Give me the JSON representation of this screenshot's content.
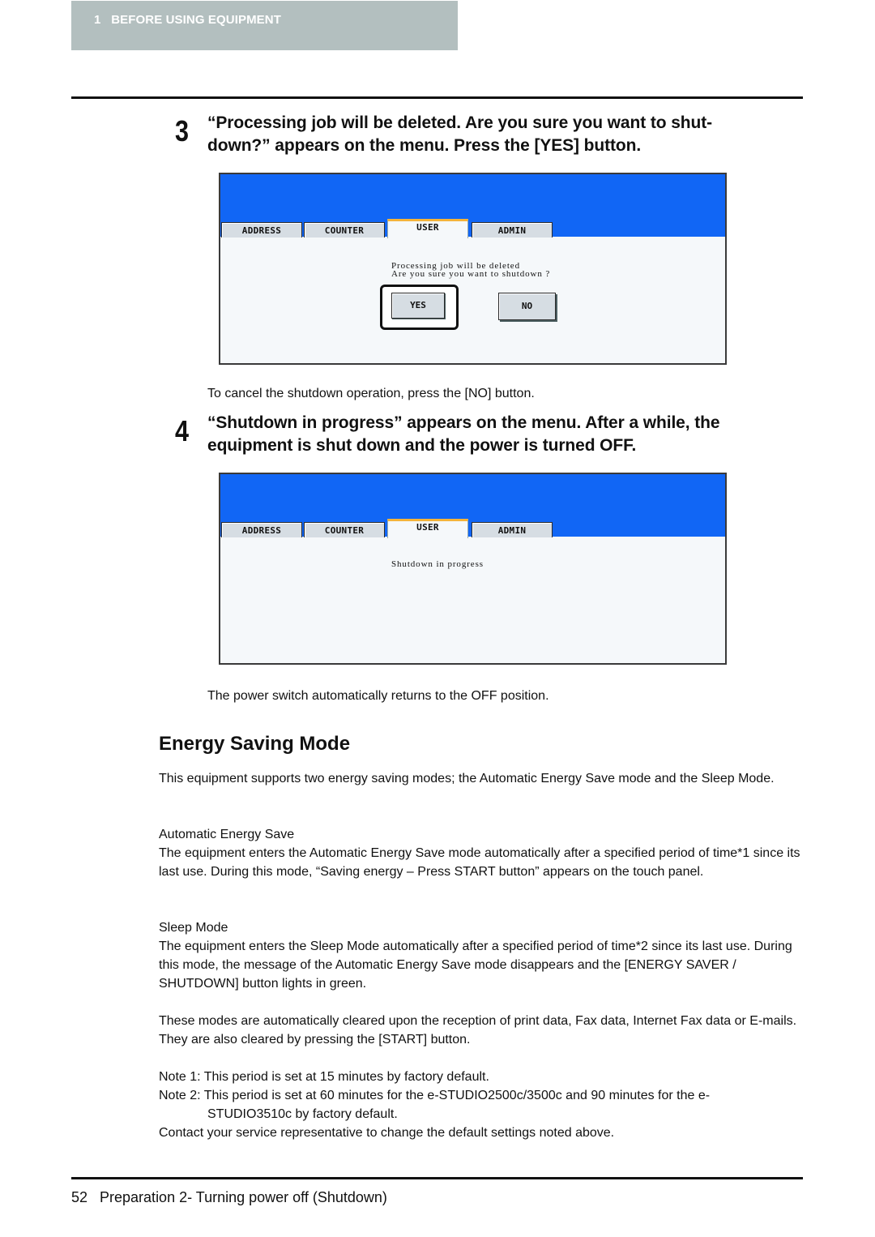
{
  "header": {
    "chapter_label": "1   BEFORE USING EQUIPMENT"
  },
  "colors": {
    "chapter_tab_bg": "#b3bfbf",
    "panel_header_blue": "#1166f5",
    "active_tab_accent": "#f5b43a",
    "button_face": "#d6dde3"
  },
  "steps": [
    {
      "number": "3",
      "text": "“Processing job will be deleted. Are you sure you want to shut-down?” appears on the menu. Press the [YES] button.",
      "line1": "“Processing job will be deleted. Are you sure you want to shut-",
      "line2": "down?” appears on the menu. Press the [YES] button."
    },
    {
      "number": "4",
      "line1": "“Shutdown in progress” appears on the menu. After a while, the",
      "line2": "equipment is shut down and the power is turned OFF."
    }
  ],
  "panel_confirm": {
    "tabs": [
      "ADDRESS",
      "COUNTER",
      "USER",
      "ADMIN"
    ],
    "active_tab": "USER",
    "message_line1": "Processing job will be deleted",
    "message_line2": "Are you sure you want to shutdown ?",
    "yes_label": "YES",
    "no_label": "NO",
    "highlighted_button": "YES"
  },
  "panel_progress": {
    "tabs": [
      "ADDRESS",
      "COUNTER",
      "USER",
      "ADMIN"
    ],
    "active_tab": "USER",
    "message": "Shutdown in progress"
  },
  "notes_after_panels": {
    "cancel_note": "To cancel the shutdown operation, press the [NO] button.",
    "power_note": "The power switch automatically returns to the OFF position."
  },
  "energy_section": {
    "heading": "Energy Saving Mode",
    "intro": "This equipment supports two energy saving modes; the Automatic Energy Save mode and the Sleep Mode.",
    "auto_title": "Automatic Energy Save",
    "auto_body": "The equipment enters the Automatic Energy Save mode automatically after a specified period of time*1 since its last use. During this mode, “Saving energy – Press START button” appears on the touch panel.",
    "sleep_title": "Sleep Mode",
    "sleep_body": "The equipment enters the Sleep Mode automatically after a specified period of time*2 since its last use. During this mode, the message of the Automatic Energy Save mode disappears and the [ENERGY SAVER / SHUTDOWN] button lights in green.",
    "clear_body": "These modes are automatically cleared upon the reception of print data, Fax data, Internet Fax data or E-mails. They are also cleared by pressing the [START] button.",
    "note1": "Note 1: This period is set at 15 minutes by factory default.",
    "note2_line1": "Note 2: This period is set at 60 minutes for the e-STUDIO2500c/3500c and 90 minutes for the e-",
    "note2_line2": "STUDIO3510c by factory default.",
    "contact": "Contact your service representative to change the default settings noted above."
  },
  "footer": {
    "page_number": "52",
    "title": "Preparation 2- Turning power off (Shutdown)",
    "text": "52   Preparation 2- Turning power off (Shutdown)"
  }
}
